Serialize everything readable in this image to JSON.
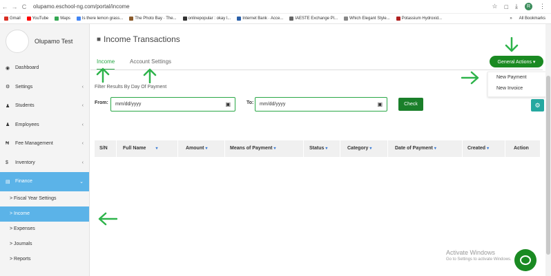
{
  "browser": {
    "url": "olupamo.eschool-ng.com/portal/income",
    "nav_back": "←",
    "nav_forward": "→",
    "nav_reload": "C",
    "star_icon": "☆",
    "ext_icon": "□",
    "download_icon": "⤓",
    "profile": "R",
    "menu_icon": "⋮"
  },
  "bookmarks": {
    "items": [
      {
        "label": "Gmail",
        "color": "#d93025"
      },
      {
        "label": "YouTube",
        "color": "#ff0000"
      },
      {
        "label": "Maps",
        "color": "#34a853"
      },
      {
        "label": "Is there lemon grass...",
        "color": "#4285f4"
      },
      {
        "label": "The Photo Bay · The...",
        "color": "#8a5a2b"
      },
      {
        "label": "onlinepopular : okay l...",
        "color": "#333333"
      },
      {
        "label": "Internet Bank · Acce...",
        "color": "#2a5fa8"
      },
      {
        "label": "IAESTE Exchange Pl...",
        "color": "#666666"
      },
      {
        "label": "Which Elegant Style...",
        "color": "#888888"
      },
      {
        "label": "Potassium Hydroxid...",
        "color": "#b02020"
      }
    ],
    "more": "»",
    "all_bookmarks": "All Bookmarks"
  },
  "sidebar": {
    "school_name": "Olupamo Test",
    "items": [
      {
        "label": "Dashboard",
        "icon": "◉",
        "chevron": ""
      },
      {
        "label": "Settings",
        "icon": "⚙",
        "chevron": "‹"
      },
      {
        "label": "Students",
        "icon": "♟",
        "chevron": "‹"
      },
      {
        "label": "Employees",
        "icon": "♟",
        "chevron": "‹"
      },
      {
        "label": "Fee Management",
        "icon": "₦",
        "chevron": "‹"
      },
      {
        "label": "Inventory",
        "icon": "$",
        "chevron": "‹"
      },
      {
        "label": "Finance",
        "icon": "▤",
        "chevron": "⌄"
      }
    ],
    "sub_items": [
      {
        "label": "> Fiscal Year Settings"
      },
      {
        "label": "> Income"
      },
      {
        "label": "> Expenses"
      },
      {
        "label": "> Journals"
      },
      {
        "label": "> Reports"
      }
    ]
  },
  "main": {
    "page_title": "Income Transactions",
    "page_icon": "■",
    "tabs": [
      {
        "label": "Income"
      },
      {
        "label": "Account Settings"
      }
    ],
    "general_actions": "General Actions ▾",
    "dropdown": [
      {
        "label": "New Payment"
      },
      {
        "label": "New Invoice"
      }
    ],
    "filter_label": "Filter Results By Day Of Payment",
    "from_label": "From:",
    "to_label": "To:",
    "from_placeholder": "mm/dd/yyyy",
    "to_placeholder": "mm/dd/yyyy",
    "calendar_icon": "▣",
    "check_label": "Check",
    "gear_icon": "⚙",
    "table_headers": [
      {
        "label": "S/N",
        "sort": ""
      },
      {
        "label": "Full Name",
        "sort": "▾"
      },
      {
        "label": "Amount",
        "sort": "▾"
      },
      {
        "label": "Means of Payment",
        "sort": "▾"
      },
      {
        "label": "Status",
        "sort": "▾"
      },
      {
        "label": "Category",
        "sort": "▾"
      },
      {
        "label": "Date of Payment",
        "sort": "▾"
      },
      {
        "label": "Created",
        "sort": "▾"
      },
      {
        "label": "Action",
        "sort": ""
      }
    ]
  },
  "watermark": {
    "line1": "Activate Windows",
    "line2": "Go to Settings to activate Windows."
  },
  "colors": {
    "accent_green": "#1a8a22",
    "sidebar_active": "#5bb3e8",
    "annotation_arrow": "#2db34a"
  }
}
